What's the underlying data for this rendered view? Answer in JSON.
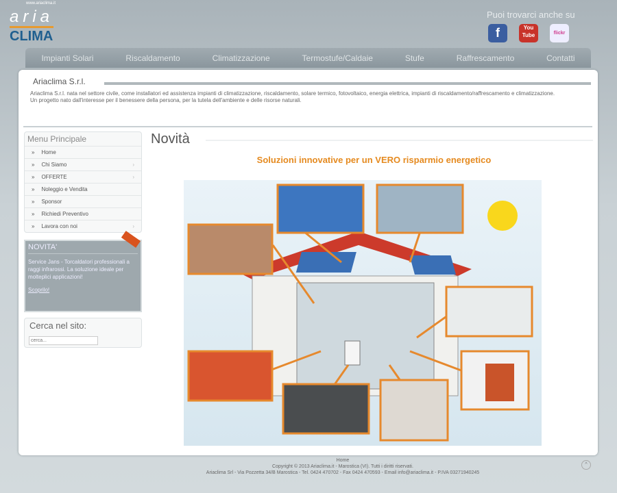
{
  "browser": {
    "url": "www.ariaclima.it"
  },
  "logo": {
    "top": "aria",
    "bottom": "CLIMA"
  },
  "social": {
    "label": "Puoi trovarci anche su",
    "facebook": "f",
    "youtube": "You Tube",
    "flickr": "flickr"
  },
  "nav": [
    "Impianti Solari",
    "Riscaldamento",
    "Climatizzazione",
    "Termostufe/Caldaie",
    "Stufe",
    "Raffrescamento",
    "Contatti"
  ],
  "intro": {
    "title": "Ariaclima S.r.l.",
    "text1": "Ariaclima S.r.l. nata nel settore civile, come installatori ed assistenza impianti di climatizzazione, riscaldamento, solare termico, fotovoltaico, energia elettrica, impianti di riscaldamento/raffrescamento e climatizzazione.",
    "text2": "Un progetto nato dall'interesse per il benessere della persona, per la tutela dell'ambiente e delle risorse naturali."
  },
  "sidebar": {
    "menu_title": "Menu Principale",
    "items": [
      "Home",
      "Chi Siamo",
      "OFFERTE",
      "Noleggio e Vendita",
      "Sponsor",
      "Richiedi Preventivo",
      "Lavora con noi"
    ],
    "novita": {
      "title": "NOVITA'",
      "text": "Service Jans - Torcaldatori professionali a raggi infrarossi. La soluzione ideale per molteplici applicazioni!",
      "link": "Scoprilo!"
    },
    "search": {
      "title": "Cerca nel sito:",
      "placeholder": "cerca..."
    }
  },
  "content": {
    "title": "Novità",
    "subtitle": "Soluzioni innovative per un VERO risparmio energetico"
  },
  "footer": {
    "line0": "Home",
    "line1": "Copyright © 2013 Ariaclima.it - Marostica (VI). Tutti i diritti riservati.",
    "line2": "Ariaclima Srl - Via Pozzetta 34/B Marostica - Tel. 0424 470702 - Fax 0424 470593 - Email info@ariaclima.it - P.IVA 03271940245",
    "top": "^"
  }
}
